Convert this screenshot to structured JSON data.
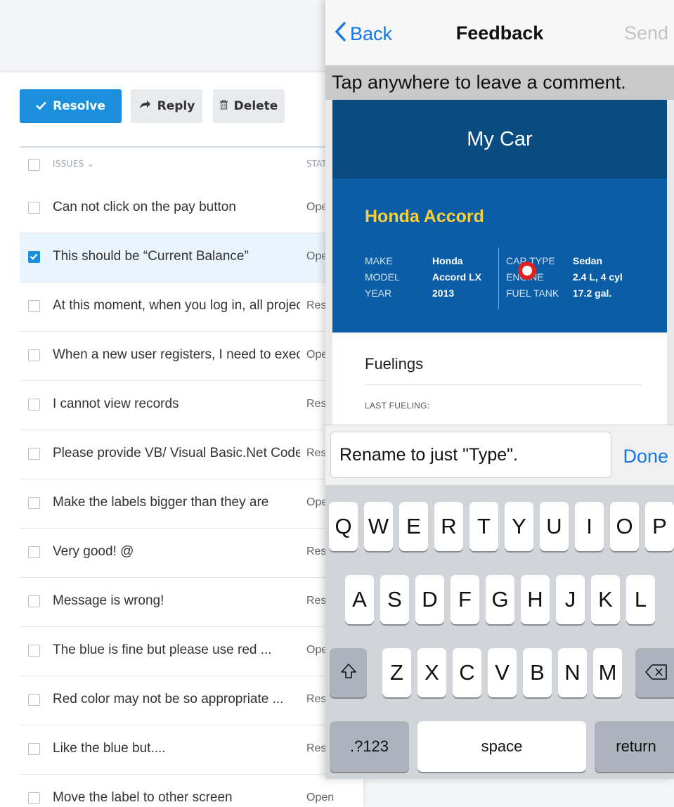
{
  "toolbar": {
    "resolve_label": "Resolve",
    "reply_label": "Reply",
    "delete_label": "Delete"
  },
  "list_header": {
    "issues_label": "ISSUES",
    "status_label": "STATUS"
  },
  "issues": [
    {
      "title": "Can not click on the pay button",
      "status": "Open",
      "checked": false
    },
    {
      "title": "This should be “Current Balance”",
      "status": "Open",
      "checked": true
    },
    {
      "title": "At this moment, when you log in, all projects",
      "status": "Resolved",
      "checked": false
    },
    {
      "title": "When a new user registers, I need to execute",
      "status": "Open",
      "checked": false
    },
    {
      "title": "I cannot view records",
      "status": "Resolved",
      "checked": false
    },
    {
      "title": "Please provide VB/ Visual Basic.Net Code",
      "status": "Resolved",
      "checked": false
    },
    {
      "title": "Make the labels bigger than they are",
      "status": "Open",
      "checked": false
    },
    {
      "title": "Very good! @",
      "status": "Resolved",
      "checked": false
    },
    {
      "title": "Message is wrong!",
      "status": "Resolved",
      "checked": false
    },
    {
      "title": "The blue is fine but please use red ...",
      "status": "Open",
      "checked": false
    },
    {
      "title": "Red color may not be so appropriate ...",
      "status": "Resolved",
      "checked": false
    },
    {
      "title": "Like the blue but....",
      "status": "Resolved",
      "checked": false
    },
    {
      "title": "Move the label to other screen",
      "status": "Open",
      "checked": false
    }
  ],
  "phone": {
    "nav": {
      "back_label": "Back",
      "title": "Feedback",
      "send_label": "Send"
    },
    "hint": "Tap anywhere to leave a comment.",
    "card": {
      "header": "My Car",
      "car_name": "Honda Accord",
      "specs_left": [
        {
          "label": "MAKE",
          "value": "Honda"
        },
        {
          "label": "MODEL",
          "value": "Accord LX"
        },
        {
          "label": "YEAR",
          "value": "2013"
        }
      ],
      "specs_right": [
        {
          "label": "CAR TYPE",
          "value": "Sedan"
        },
        {
          "label": "ENGINE",
          "value": "2.4 L, 4 cyl"
        },
        {
          "label": "FUEL TANK",
          "value": "17.2 gal."
        }
      ],
      "fuelings_title": "Fuelings",
      "last_fueling_label": "LAST FUELING:"
    },
    "comment": {
      "value": "Rename to just \"Type\".",
      "done_label": "Done"
    },
    "keyboard": {
      "row1": [
        "Q",
        "W",
        "E",
        "R",
        "T",
        "Y",
        "U",
        "I",
        "O",
        "P"
      ],
      "row2": [
        "A",
        "S",
        "D",
        "F",
        "G",
        "H",
        "J",
        "K",
        "L"
      ],
      "row3": [
        "Z",
        "X",
        "C",
        "V",
        "B",
        "N",
        "M"
      ],
      "numbers_label": ".?123",
      "space_label": "space",
      "return_label": "return"
    }
  }
}
